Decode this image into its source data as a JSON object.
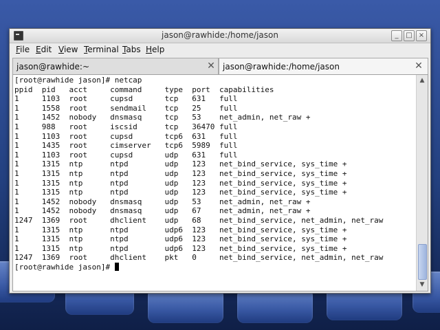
{
  "window": {
    "title": "jason@rawhide:/home/jason",
    "controls": {
      "minimize": "_",
      "maximize": "□",
      "close": "×"
    }
  },
  "menu": [
    "File",
    "Edit",
    "View",
    "Terminal",
    "Tabs",
    "Help"
  ],
  "tabs": [
    {
      "label": "jason@rawhide:~",
      "active": false
    },
    {
      "label": "jason@rawhide:/home/jason",
      "active": true
    }
  ],
  "terminal": {
    "lines": [
      "[root@rawhide jason]# netcap",
      "ppid  pid   acct     command     type  port  capabilities",
      "1     1103  root     cupsd       tcp   631   full",
      "1     1558  root     sendmail    tcp   25    full",
      "1     1452  nobody   dnsmasq     tcp   53    net_admin, net_raw +",
      "1     988   root     iscsid      tcp   36470 full",
      "1     1103  root     cupsd       tcp6  631   full",
      "1     1435  root     cimserver   tcp6  5989  full",
      "1     1103  root     cupsd       udp   631   full",
      "1     1315  ntp      ntpd        udp   123   net_bind_service, sys_time +",
      "1     1315  ntp      ntpd        udp   123   net_bind_service, sys_time +",
      "1     1315  ntp      ntpd        udp   123   net_bind_service, sys_time +",
      "1     1315  ntp      ntpd        udp   123   net_bind_service, sys_time +",
      "1     1452  nobody   dnsmasq     udp   53    net_admin, net_raw +",
      "1     1452  nobody   dnsmasq     udp   67    net_admin, net_raw +",
      "1247  1369  root     dhclient    udp   68    net_bind_service, net_admin, net_raw",
      "1     1315  ntp      ntpd        udp6  123   net_bind_service, sys_time +",
      "1     1315  ntp      ntpd        udp6  123   net_bind_service, sys_time +",
      "1     1315  ntp      ntpd        udp6  123   net_bind_service, sys_time +",
      "1247  1369  root     dhclient    pkt   0     net_bind_service, net_admin, net_raw",
      "[root@rawhide jason]# "
    ]
  },
  "scrollbar": {
    "up": "▲",
    "down": "▼"
  },
  "colors": {
    "desktop": "#2a3f7a",
    "terminal_bg": "#ffffff",
    "terminal_fg": "#111111"
  }
}
